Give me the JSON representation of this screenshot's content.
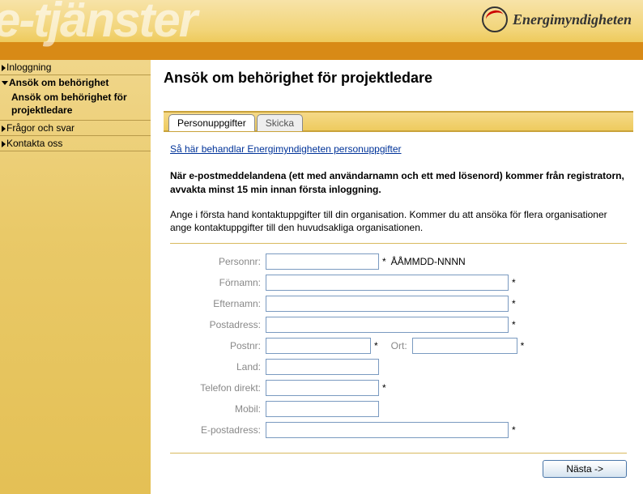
{
  "header": {
    "watermark": "e-tjänster",
    "logo_text": "Energimyndigheten"
  },
  "sidebar": {
    "items": [
      {
        "label": "Inloggning",
        "type": "link"
      },
      {
        "label": "Ansök om behörighet",
        "type": "active"
      },
      {
        "label": "Ansök om behörighet för projektledare",
        "type": "sub"
      },
      {
        "label": "Frågor och svar",
        "type": "link"
      },
      {
        "label": "Kontakta oss",
        "type": "link"
      }
    ]
  },
  "main": {
    "title": "Ansök om behörighet för projektledare",
    "tabs": [
      {
        "label": "Personuppgifter",
        "active": true
      },
      {
        "label": "Skicka",
        "active": false
      }
    ],
    "privacy_link": "Så här behandlar Energimyndigheten personuppgifter",
    "notice": "När e-postmeddelandena (ett med användarnamn och ett med lösenord) kommer från registratorn, avvakta minst 15 min innan första inloggning.",
    "instruction": "Ange i första hand kontaktuppgifter till din organisation. Kommer du att ansöka för flera organisationer ange kontaktuppgifter till den huvudsakliga organisationen.",
    "form": {
      "personnr_label": "Personnr:",
      "personnr_hint": "ÅÅMMDD-NNNN",
      "fornamn_label": "Förnamn:",
      "efternamn_label": "Efternamn:",
      "postadress_label": "Postadress:",
      "postnr_label": "Postnr:",
      "ort_label": "Ort:",
      "land_label": "Land:",
      "telefon_label": "Telefon direkt:",
      "mobil_label": "Mobil:",
      "epost_label": "E-postadress:",
      "required_mark": "*"
    },
    "next_button": "Nästa ->"
  }
}
